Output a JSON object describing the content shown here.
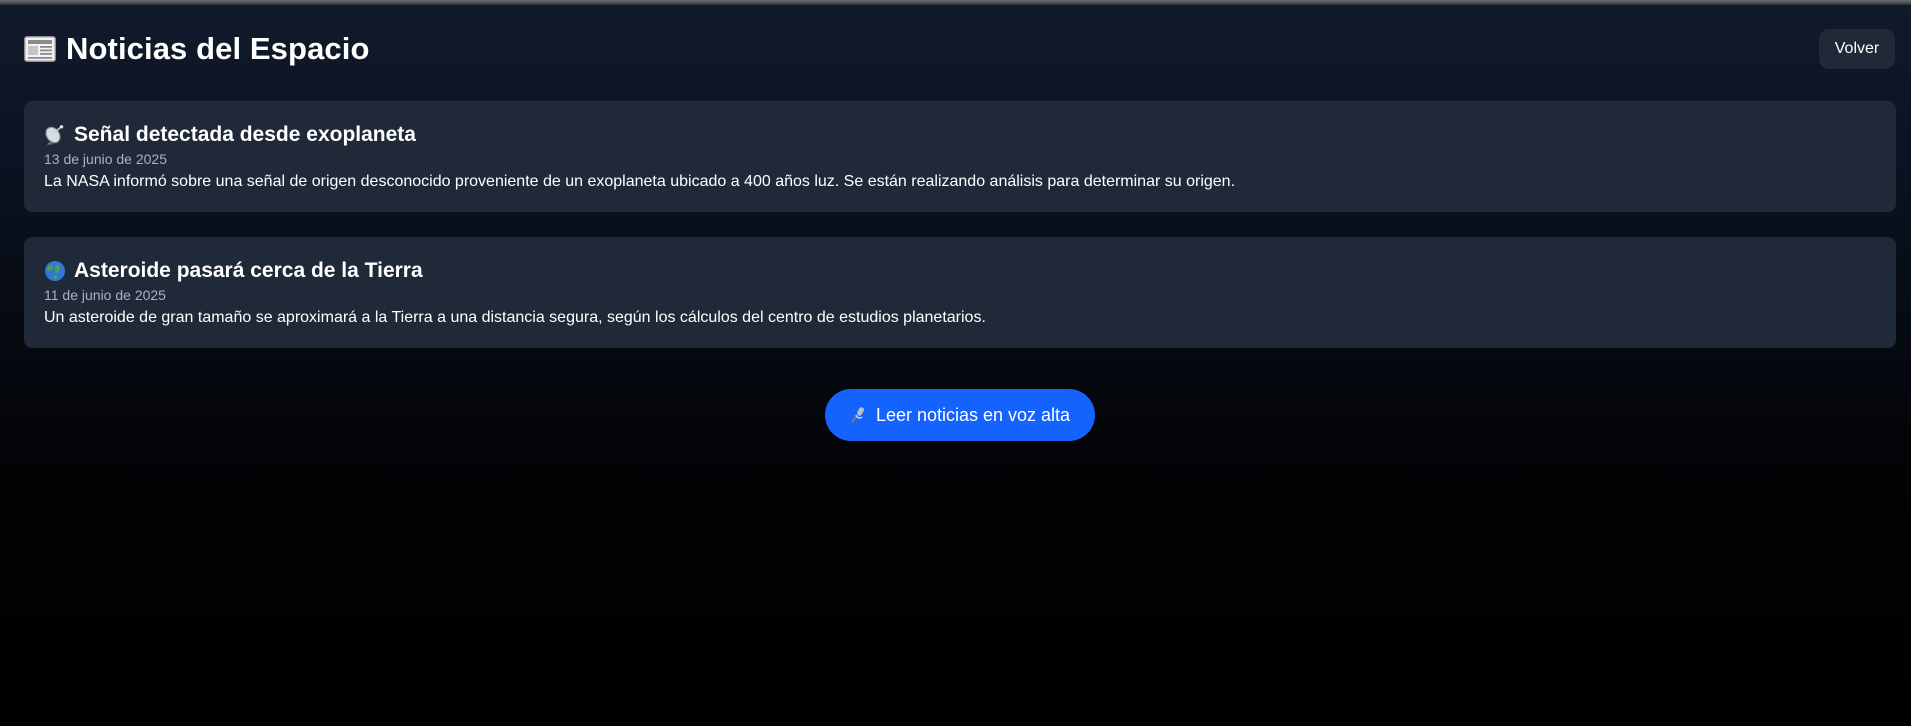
{
  "header": {
    "title": "Noticias del Espacio",
    "back_label": "Volver",
    "icon": "newspaper-icon"
  },
  "news": [
    {
      "icon": "satellite-dish-icon",
      "title": "Señal detectada desde exoplaneta",
      "date": "13 de junio de 2025",
      "body": "La NASA informó sobre una señal de origen desconocido proveniente de un exoplaneta ubicado a 400 años luz. Se están realizando análisis para determinar su origen."
    },
    {
      "icon": "earth-globe-icon",
      "title": "Asteroide pasará cerca de la Tierra",
      "date": "11 de junio de 2025",
      "body": "Un asteroide de gran tamaño se aproximará a la Tierra a una distancia segura, según los cálculos del centro de estudios planetarios."
    }
  ],
  "actions": {
    "read_aloud_label": "Leer noticias en voz alta",
    "read_aloud_icon": "microphone-icon"
  },
  "colors": {
    "card_bg": "#1f2937",
    "accent": "#1463ff",
    "date_text": "#a9b2c1"
  }
}
